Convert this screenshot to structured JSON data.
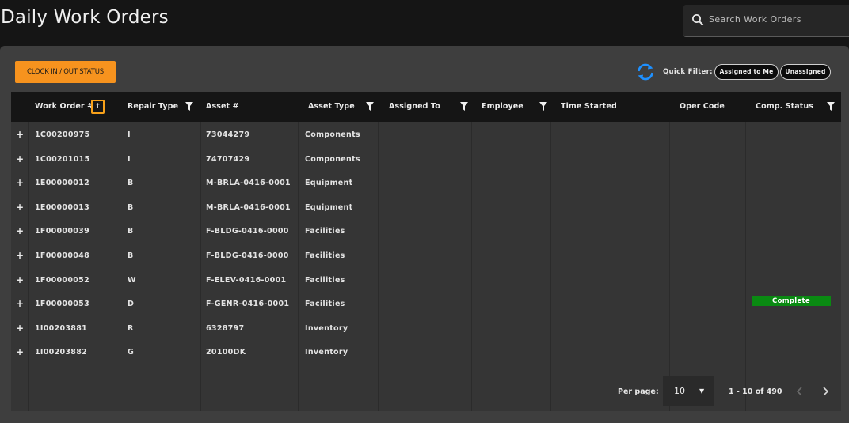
{
  "header": {
    "title": "Daily Work Orders",
    "search_placeholder": "Search Work Orders"
  },
  "toolbar": {
    "clock_button": "CLOCK IN / OUT STATUS",
    "quick_filter_label": "Quick Filter:",
    "chips": [
      "Assigned to Me",
      "Unassigned"
    ]
  },
  "table": {
    "columns": [
      "Work Order #",
      "Repair Type",
      "Asset #",
      "Asset Type",
      "Assigned To",
      "Employee",
      "Time Started",
      "Oper Code",
      "Comp. Status"
    ],
    "sort_indicator": "↑",
    "expand_symbol": "+",
    "rows": [
      {
        "work_order": "1C00200975",
        "repair_type": "I",
        "asset": "73044279",
        "asset_type": "Components"
      },
      {
        "work_order": "1C00201015",
        "repair_type": "I",
        "asset": "74707429",
        "asset_type": "Components"
      },
      {
        "work_order": "1E00000012",
        "repair_type": "B",
        "asset": "M-BRLA-0416-0001",
        "asset_type": "Equipment"
      },
      {
        "work_order": "1E00000013",
        "repair_type": "B",
        "asset": "M-BRLA-0416-0001",
        "asset_type": "Equipment"
      },
      {
        "work_order": "1F00000039",
        "repair_type": "B",
        "asset": "F-BLDG-0416-0000",
        "asset_type": "Facilities"
      },
      {
        "work_order": "1F00000048",
        "repair_type": "B",
        "asset": "F-BLDG-0416-0000",
        "asset_type": "Facilities"
      },
      {
        "work_order": "1F00000052",
        "repair_type": "W",
        "asset": "F-ELEV-0416-0001",
        "asset_type": "Facilities"
      },
      {
        "work_order": "1F00000053",
        "repair_type": "D",
        "asset": "F-GENR-0416-0001",
        "asset_type": "Facilities"
      },
      {
        "work_order": "1I00203881",
        "repair_type": "R",
        "asset": "6328797",
        "asset_type": "Inventory"
      },
      {
        "work_order": "1I00203882",
        "repair_type": "G",
        "asset": "20100DK",
        "asset_type": "Inventory"
      }
    ],
    "status_badge": "Complete"
  },
  "pagination": {
    "per_page_label": "Per page:",
    "per_page_value": "10",
    "range": "1 - 10 of 490"
  },
  "colors": {
    "accent": "#f7931e",
    "complete": "#0a8a12",
    "refresh": "#1e90ff"
  }
}
